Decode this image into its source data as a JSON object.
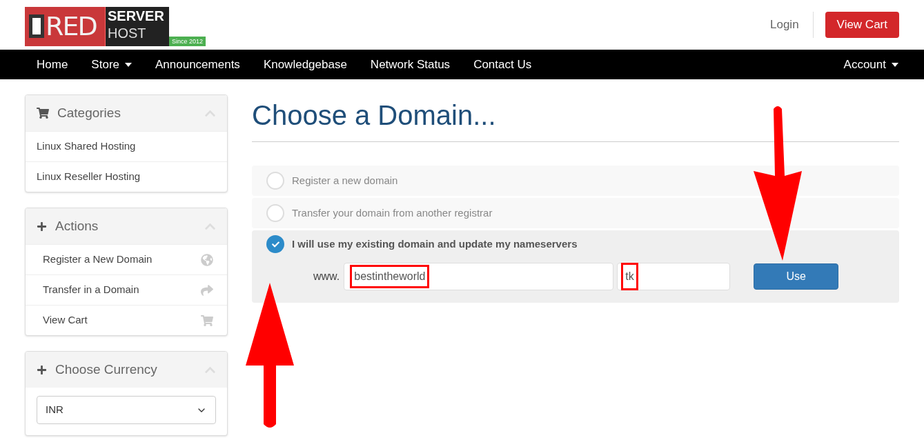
{
  "logo": {
    "word": "RED",
    "line_1": "SERVER",
    "line_2": "HOST",
    "since": "Since 2012"
  },
  "header": {
    "login": "Login",
    "view_cart": "View Cart"
  },
  "nav": {
    "items": [
      {
        "label": "Home",
        "dropdown": false
      },
      {
        "label": "Store",
        "dropdown": true
      },
      {
        "label": "Announcements",
        "dropdown": false
      },
      {
        "label": "Knowledgebase",
        "dropdown": false
      },
      {
        "label": "Network Status",
        "dropdown": false
      },
      {
        "label": "Contact Us",
        "dropdown": false
      }
    ],
    "account": {
      "label": "Account",
      "dropdown": true
    }
  },
  "sidebar": [
    {
      "title": "Categories",
      "kind": "cart",
      "items": [
        {
          "label": "Linux Shared Hosting"
        },
        {
          "label": "Linux Reseller Hosting"
        }
      ]
    },
    {
      "title": "Actions",
      "kind": "plus",
      "items": [
        {
          "label": "Register a New Domain",
          "kind": "globe"
        },
        {
          "label": "Transfer in a Domain",
          "kind": "share"
        },
        {
          "label": "View Cart",
          "kind": "cart"
        }
      ]
    },
    {
      "title": "Choose Currency",
      "kind": "plus",
      "select": "INR"
    }
  ],
  "main": {
    "title": "Choose a Domain...",
    "options": [
      {
        "label": "Register a new domain",
        "selected": false
      },
      {
        "label": "Transfer your domain from another registrar",
        "selected": false
      },
      {
        "label": "I will use my existing domain and update my nameservers",
        "selected": true
      }
    ],
    "prefix": "www.",
    "domain": "bestintheworld",
    "tld": "tk",
    "button": "Use"
  }
}
